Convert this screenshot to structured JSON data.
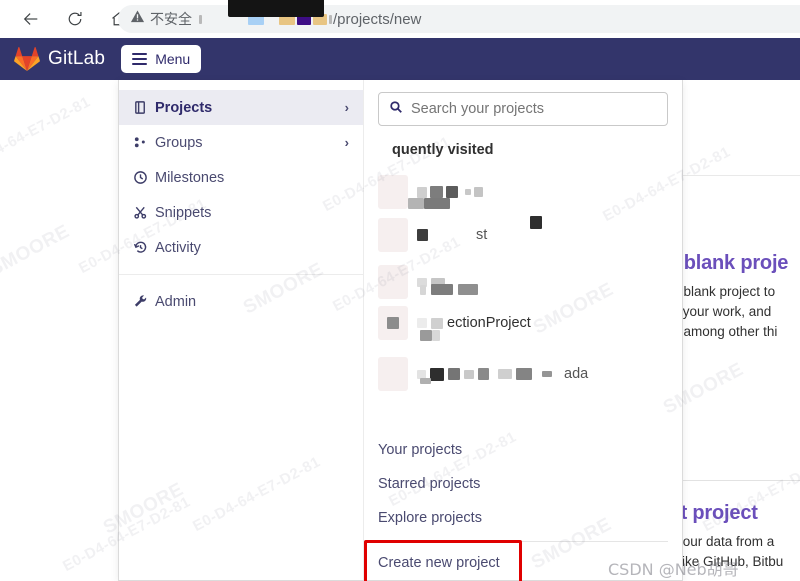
{
  "browser": {
    "back_icon": "back-arrow-icon",
    "reload_icon": "reload-icon",
    "home_icon": "home-icon",
    "security_warning": "不安全",
    "warning_icon": "warning-triangle-icon",
    "url_tail": "/projects/new"
  },
  "navbar": {
    "brand": "GitLab",
    "logo_icon": "gitlab-tanuki-logo",
    "menu_label": "Menu",
    "menu_icon": "hamburger-icon",
    "bg_color": "#33356b"
  },
  "dropdown": {
    "left_items": [
      {
        "label": "Projects",
        "icon": "projects-icon",
        "chevron": "›",
        "active": true
      },
      {
        "label": "Groups",
        "icon": "groups-icon",
        "chevron": "›",
        "active": false
      },
      {
        "label": "Milestones",
        "icon": "clock-icon",
        "chevron": "",
        "active": false
      },
      {
        "label": "Snippets",
        "icon": "scissors-icon",
        "chevron": "",
        "active": false
      },
      {
        "label": "Activity",
        "icon": "history-icon",
        "chevron": "",
        "active": false
      }
    ],
    "admin_item": {
      "label": "Admin",
      "icon": "wrench-icon"
    },
    "search": {
      "placeholder": "Search your projects",
      "value": "",
      "icon": "search-icon"
    },
    "frequently_visited_title": "quently visited",
    "projects": [
      {
        "visible_text": ""
      },
      {
        "visible_text": "st"
      },
      {
        "visible_text": ""
      },
      {
        "visible_text": "ectionProject"
      },
      {
        "visible_text": "ada"
      }
    ],
    "links": [
      {
        "label": "Your projects"
      },
      {
        "label": "Starred projects"
      },
      {
        "label": "Explore projects"
      }
    ],
    "create_link": {
      "label": "Create new project",
      "highlight_color": "#e00000"
    }
  },
  "page_background": {
    "card_one": {
      "title": "te blank proje",
      "lines": [
        "e a blank project to",
        "lan your work, and",
        "de, among other thi"
      ]
    },
    "card_two": {
      "title": "ort project",
      "lines": [
        "te your data from a",
        "ce like GitHub, Bitbu"
      ]
    }
  },
  "watermarks": {
    "brand": "SMOORE",
    "code": "E0-D4-64-E7-D2-81",
    "csdn": "CSDN @Neb胡哥"
  }
}
